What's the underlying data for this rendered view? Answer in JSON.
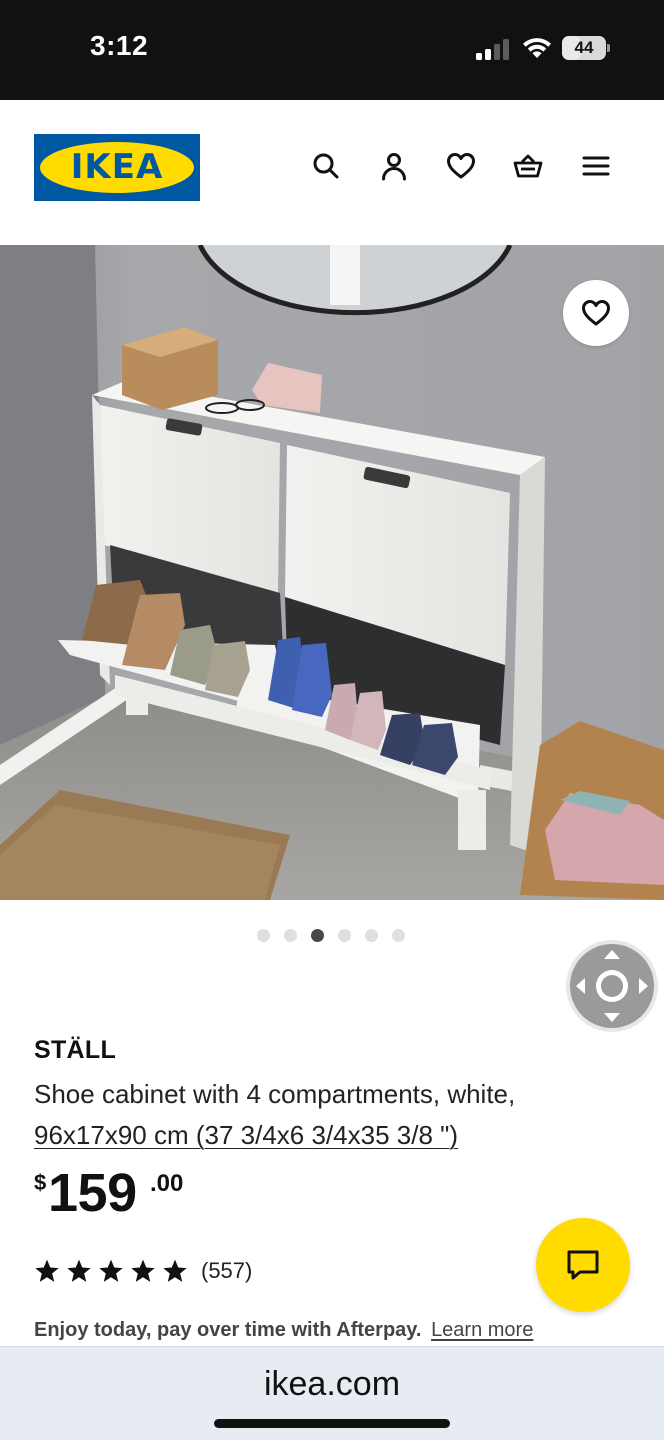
{
  "status_bar": {
    "time": "3:12",
    "battery": "44",
    "battery_percent": 44
  },
  "header": {
    "logo_text": "IKEA",
    "icons": [
      "search-icon",
      "account-icon",
      "wishlist-heart-icon",
      "shopping-bag-icon",
      "menu-icon"
    ]
  },
  "gallery": {
    "image_count": 6,
    "active_index": 2
  },
  "product": {
    "name": "STÄLL",
    "description": "Shoe cabinet with 4 compartments, white,",
    "measurements": "96x17x90 cm (37 3/4x6 3/4x35 3/8 \")",
    "price": {
      "currency": "$",
      "integer": "159",
      "decimal": ".00"
    },
    "rating": {
      "stars": 5,
      "count": "(557)"
    }
  },
  "afterpay": {
    "text": "Enjoy today, pay over time with Afterpay.",
    "link": "Learn more"
  },
  "browser": {
    "url": "ikea.com"
  },
  "colors": {
    "ikea_blue": "#0058a3",
    "ikea_yellow": "#ffdb00",
    "status_bar": "#111111",
    "url_bar": "#e7ecf3"
  }
}
